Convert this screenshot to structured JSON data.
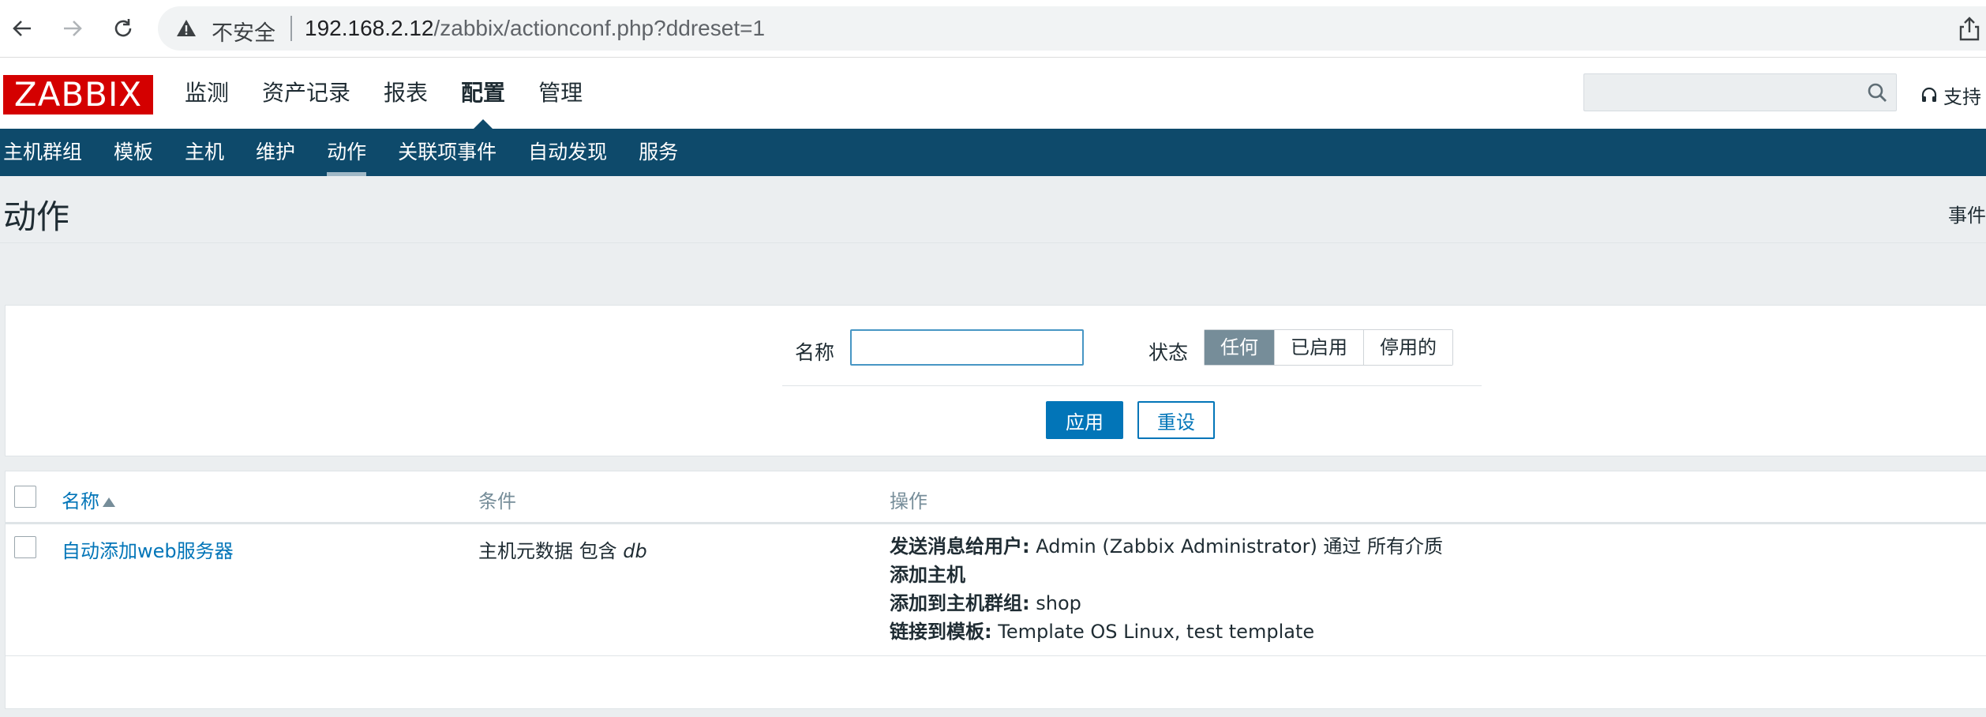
{
  "browser": {
    "insecure_label": "不安全",
    "url_host": "192.168.2.12",
    "url_path": "/zabbix/actionconf.php?ddreset=1"
  },
  "logo": "ZABBIX",
  "top_menu": [
    "监测",
    "资产记录",
    "报表",
    "配置",
    "管理"
  ],
  "support_label": "支持",
  "search": {
    "value": ""
  },
  "sub_menu": [
    "主机群组",
    "模板",
    "主机",
    "维护",
    "动作",
    "关联项事件",
    "自动发现",
    "服务"
  ],
  "page": {
    "title": "动作",
    "right_selector": "事件"
  },
  "filter": {
    "name_label": "名称",
    "name_value": "",
    "status_label": "状态",
    "status_options": [
      "任何",
      "已启用",
      "停用的"
    ],
    "status_selected": "任何",
    "apply": "应用",
    "reset": "重设"
  },
  "table": {
    "headers": {
      "name": "名称",
      "conditions": "条件",
      "operations": "操作"
    },
    "rows": [
      {
        "name": "自动添加web服务器",
        "condition_text": "主机元数据 包含 ",
        "condition_value": "db",
        "operations": [
          {
            "label": "发送消息给用户:",
            "value": " Admin (Zabbix Administrator) 通过 所有介质"
          },
          {
            "label": "添加主机",
            "value": ""
          },
          {
            "label": "添加到主机群组:",
            "value": " shop"
          },
          {
            "label": "链接到模板:",
            "value": " Template OS Linux, test template"
          }
        ]
      }
    ]
  },
  "colors": {
    "brand_red": "#d40000",
    "nav_blue": "#0e4a6b",
    "link_blue": "#0275b8",
    "segment_active": "#768d99"
  }
}
